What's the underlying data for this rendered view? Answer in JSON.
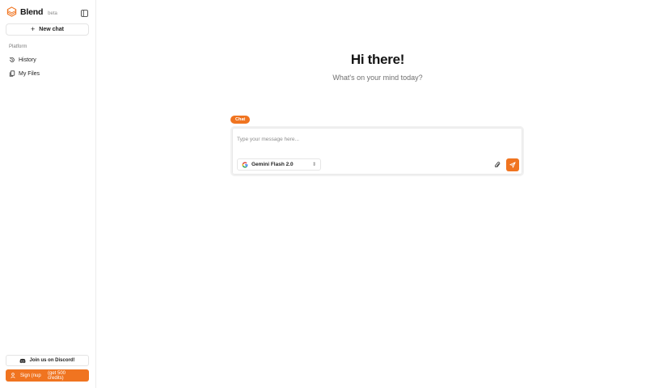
{
  "brand": {
    "name": "Blend",
    "badge": "beta"
  },
  "sidebar": {
    "new_chat_label": "New chat",
    "section_label": "Platform",
    "items": [
      {
        "label": "History",
        "icon": "history-icon"
      },
      {
        "label": "My Files",
        "icon": "files-icon"
      }
    ],
    "discord_label": "Join us on Discord!",
    "signup_label": "Sign (nup",
    "signup_sub": "(get 500 credits)"
  },
  "main": {
    "title": "Hi there!",
    "subtitle": "What's on your mind today?",
    "mode_badge": "Chat",
    "input_placeholder": "Type your message here...",
    "model_label": "Gemini Flash 2.0"
  },
  "colors": {
    "accent": "#f07420",
    "text": "#1a1a1a",
    "muted": "#6f6f6f",
    "border": "#e6e6e6"
  }
}
